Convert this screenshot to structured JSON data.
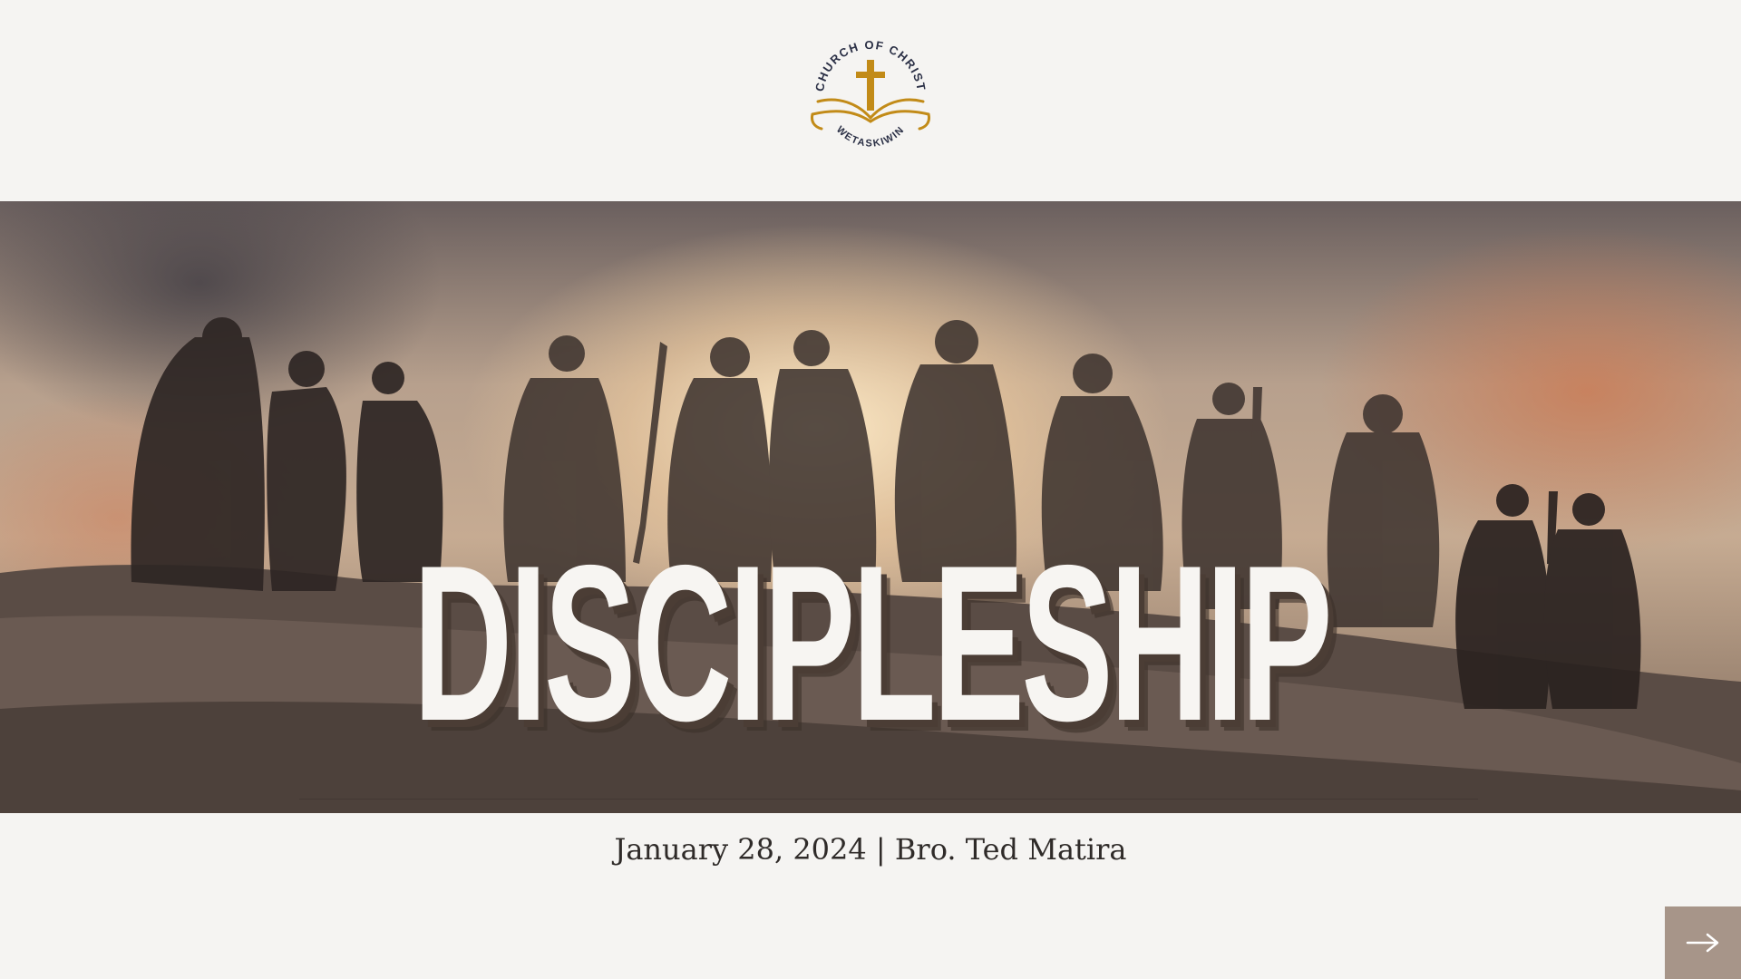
{
  "logo": {
    "top_text": "CHURCH OF CHRIST",
    "bottom_text": "WETASKIWIN",
    "colors": {
      "gold": "#c28b18",
      "text": "#2a2f45"
    }
  },
  "hero": {
    "title": "DISCIPLESHIP"
  },
  "subtitle": "January 28, 2024 | Bro. Ted Matira",
  "nav": {
    "next_icon": "arrow-right-icon",
    "button_color": "#a79589"
  }
}
